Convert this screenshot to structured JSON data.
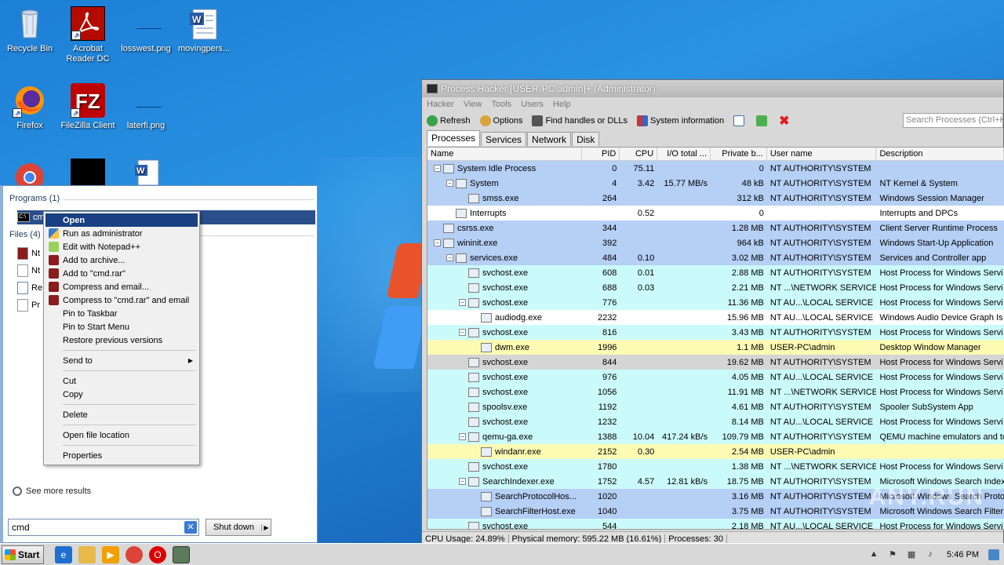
{
  "desktop": {
    "icons": [
      {
        "label": "Recycle Bin",
        "icon": "recycle-bin-icon"
      },
      {
        "label": "Acrobat Reader DC",
        "icon": "acrobat-icon"
      },
      {
        "label": "losswest.png",
        "icon": "image-file-icon"
      },
      {
        "label": "movingpers...",
        "icon": "word-doc-icon"
      },
      {
        "label": "Firefox",
        "icon": "firefox-icon"
      },
      {
        "label": "FileZilla Client",
        "icon": "filezilla-icon"
      },
      {
        "label": "laterfi.png",
        "icon": "image-file-icon"
      }
    ]
  },
  "start_menu": {
    "programs_header": "Programs (1)",
    "program_item": "cmd",
    "files_header": "Files (4)",
    "files": [
      "Nt",
      "Nt",
      "Re",
      "Pr"
    ],
    "see_more": "See more results",
    "search_value": "cmd",
    "shutdown_label": "Shut down"
  },
  "context_menu": {
    "items": [
      {
        "label": "Open",
        "highlight": true
      },
      {
        "label": "Run as administrator"
      },
      {
        "label": "Edit with Notepad++"
      },
      {
        "label": "Add to archive..."
      },
      {
        "label": "Add to \"cmd.rar\""
      },
      {
        "label": "Compress and email..."
      },
      {
        "label": "Compress to \"cmd.rar\" and email"
      },
      {
        "label": "Pin to Taskbar"
      },
      {
        "label": "Pin to Start Menu"
      },
      {
        "label": "Restore previous versions"
      },
      {
        "label": "Send to"
      },
      {
        "label": "Cut"
      },
      {
        "label": "Copy"
      },
      {
        "label": "Delete"
      },
      {
        "label": "Open file location"
      },
      {
        "label": "Properties"
      }
    ]
  },
  "process_hacker": {
    "title": "Process Hacker [USER-PC\\admin]+ (Administrator)",
    "menu": [
      "Hacker",
      "View",
      "Tools",
      "Users",
      "Help"
    ],
    "toolbar": {
      "refresh": "Refresh",
      "options": "Options",
      "find_handles": "Find handles or DLLs",
      "system_info": "System information"
    },
    "search_placeholder": "Search Processes (Ctrl+K)",
    "tabs": [
      "Processes",
      "Services",
      "Network",
      "Disk"
    ],
    "columns": [
      "Name",
      "PID",
      "CPU",
      "I/O total ...",
      "Private b...",
      "User name",
      "Description"
    ],
    "rows": [
      {
        "name": "System Idle Process",
        "pid": "0",
        "cpu": "75.11",
        "io": "",
        "priv": "0",
        "user": "NT AUTHORITY\\SYSTEM",
        "desc": "",
        "style": "blue"
      },
      {
        "name": "System",
        "pid": "4",
        "cpu": "3.42",
        "io": "15.77 MB/s",
        "priv": "48 kB",
        "user": "NT AUTHORITY\\SYSTEM",
        "desc": "NT Kernel & System",
        "style": "blue"
      },
      {
        "name": "smss.exe",
        "pid": "264",
        "cpu": "",
        "io": "",
        "priv": "312 kB",
        "user": "NT AUTHORITY\\SYSTEM",
        "desc": "Windows Session Manager",
        "style": "blue"
      },
      {
        "name": "Interrupts",
        "pid": "",
        "cpu": "0.52",
        "io": "",
        "priv": "0",
        "user": "",
        "desc": "Interrupts and DPCs",
        "style": "white"
      },
      {
        "name": "csrss.exe",
        "pid": "344",
        "cpu": "",
        "io": "",
        "priv": "1.28 MB",
        "user": "NT AUTHORITY\\SYSTEM",
        "desc": "Client Server Runtime Process",
        "style": "blue"
      },
      {
        "name": "wininit.exe",
        "pid": "392",
        "cpu": "",
        "io": "",
        "priv": "964 kB",
        "user": "NT AUTHORITY\\SYSTEM",
        "desc": "Windows Start-Up Application",
        "style": "blue"
      },
      {
        "name": "services.exe",
        "pid": "484",
        "cpu": "0.10",
        "io": "",
        "priv": "3.02 MB",
        "user": "NT AUTHORITY\\SYSTEM",
        "desc": "Services and Controller app",
        "style": "blue"
      },
      {
        "name": "svchost.exe",
        "pid": "608",
        "cpu": "0.01",
        "io": "",
        "priv": "2.88 MB",
        "user": "NT AUTHORITY\\SYSTEM",
        "desc": "Host Process for Windows Servi",
        "style": "cyan"
      },
      {
        "name": "svchost.exe",
        "pid": "688",
        "cpu": "0.03",
        "io": "",
        "priv": "2.21 MB",
        "user": "NT ...\\NETWORK SERVICE",
        "desc": "Host Process for Windows Servi",
        "style": "cyan"
      },
      {
        "name": "svchost.exe",
        "pid": "776",
        "cpu": "",
        "io": "",
        "priv": "11.36 MB",
        "user": "NT AU...\\LOCAL SERVICE",
        "desc": "Host Process for Windows Servi",
        "style": "cyan"
      },
      {
        "name": "audiodg.exe",
        "pid": "2232",
        "cpu": "",
        "io": "",
        "priv": "15.96 MB",
        "user": "NT AU...\\LOCAL SERVICE",
        "desc": "Windows Audio Device Graph Is",
        "style": "white"
      },
      {
        "name": "svchost.exe",
        "pid": "816",
        "cpu": "",
        "io": "",
        "priv": "3.43 MB",
        "user": "NT AUTHORITY\\SYSTEM",
        "desc": "Host Process for Windows Servi",
        "style": "cyan"
      },
      {
        "name": "dwm.exe",
        "pid": "1996",
        "cpu": "",
        "io": "",
        "priv": "1.1 MB",
        "user": "USER-PC\\admin",
        "desc": "Desktop Window Manager",
        "style": "yellow"
      },
      {
        "name": "svchost.exe",
        "pid": "844",
        "cpu": "",
        "io": "",
        "priv": "19.62 MB",
        "user": "NT AUTHORITY\\SYSTEM",
        "desc": "Host Process for Windows Servi",
        "style": "gray"
      },
      {
        "name": "svchost.exe",
        "pid": "976",
        "cpu": "",
        "io": "",
        "priv": "4.05 MB",
        "user": "NT AU...\\LOCAL SERVICE",
        "desc": "Host Process for Windows Servi",
        "style": "cyan"
      },
      {
        "name": "svchost.exe",
        "pid": "1056",
        "cpu": "",
        "io": "",
        "priv": "11.91 MB",
        "user": "NT ...\\NETWORK SERVICE",
        "desc": "Host Process for Windows Servi",
        "style": "cyan"
      },
      {
        "name": "spoolsv.exe",
        "pid": "1192",
        "cpu": "",
        "io": "",
        "priv": "4.61 MB",
        "user": "NT AUTHORITY\\SYSTEM",
        "desc": "Spooler SubSystem App",
        "style": "cyan"
      },
      {
        "name": "svchost.exe",
        "pid": "1232",
        "cpu": "",
        "io": "",
        "priv": "8.14 MB",
        "user": "NT AU...\\LOCAL SERVICE",
        "desc": "Host Process for Windows Servi",
        "style": "cyan"
      },
      {
        "name": "qemu-ga.exe",
        "pid": "1388",
        "cpu": "10.04",
        "io": "417.24 kB/s",
        "priv": "109.79 MB",
        "user": "NT AUTHORITY\\SYSTEM",
        "desc": "QEMU machine emulators and to",
        "style": "cyan"
      },
      {
        "name": "windanr.exe",
        "pid": "2152",
        "cpu": "0.30",
        "io": "",
        "priv": "2.54 MB",
        "user": "USER-PC\\admin",
        "desc": "",
        "style": "yellow"
      },
      {
        "name": "svchost.exe",
        "pid": "1780",
        "cpu": "",
        "io": "",
        "priv": "1.38 MB",
        "user": "NT ...\\NETWORK SERVICE",
        "desc": "Host Process for Windows Servi",
        "style": "cyan"
      },
      {
        "name": "SearchIndexer.exe",
        "pid": "1752",
        "cpu": "4.57",
        "io": "12.81 kB/s",
        "priv": "18.75 MB",
        "user": "NT AUTHORITY\\SYSTEM",
        "desc": "Microsoft Windows Search Index",
        "style": "cyan"
      },
      {
        "name": "SearchProtocolHos...",
        "pid": "1020",
        "cpu": "",
        "io": "",
        "priv": "3.16 MB",
        "user": "NT AUTHORITY\\SYSTEM",
        "desc": "Microsoft Windows Search Proto",
        "style": "blue"
      },
      {
        "name": "SearchFilterHost.exe",
        "pid": "1040",
        "cpu": "",
        "io": "",
        "priv": "3.75 MB",
        "user": "NT AUTHORITY\\SYSTEM",
        "desc": "Microsoft Windows Search Filter",
        "style": "blue"
      },
      {
        "name": "svchost.exe",
        "pid": "544",
        "cpu": "",
        "io": "",
        "priv": "2.18 MB",
        "user": "NT AU...\\LOCAL SERVICE",
        "desc": "Host Process for Windows Servi",
        "style": "cyan"
      }
    ],
    "status": {
      "cpu": "CPU Usage: 24.89%",
      "memory": "Physical memory: 595.22 MB (16.61%)",
      "processes": "Processes: 30"
    }
  },
  "taskbar": {
    "start_label": "Start",
    "clock": "5:46 PM"
  }
}
